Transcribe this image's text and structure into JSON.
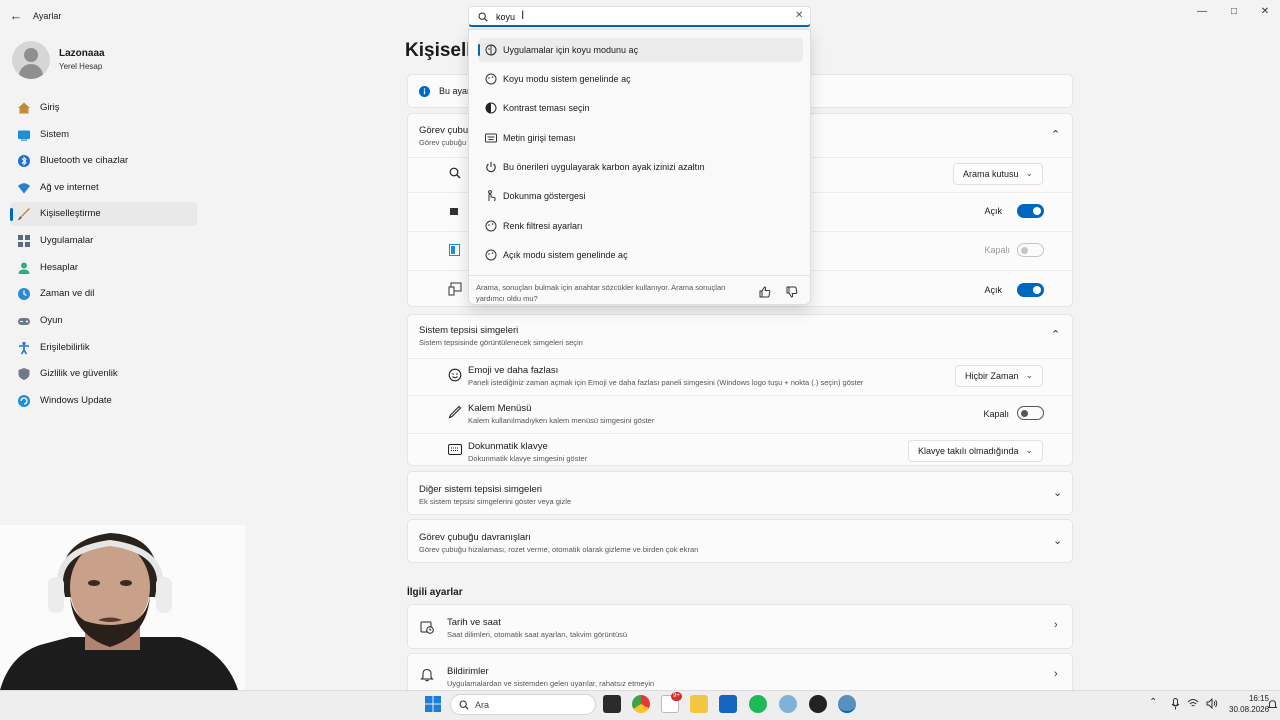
{
  "window": {
    "title": "Ayarlar"
  },
  "account": {
    "name": "Lazonaaa",
    "type": "Yerel Hesap"
  },
  "sidebar": {
    "items": [
      {
        "label": "Giriş",
        "icon": "home-icon",
        "color": "#c58b3a"
      },
      {
        "label": "Sistem",
        "icon": "monitor-icon",
        "color": "#1e8fd6"
      },
      {
        "label": "Bluetooth ve cihazlar",
        "icon": "bluetooth-icon",
        "color": "#1e6fd6"
      },
      {
        "label": "Ağ ve internet",
        "icon": "wifi-icon",
        "color": "#2a7fd0"
      },
      {
        "label": "Kişiselleştirme",
        "icon": "brush-icon",
        "color": "#d08030",
        "active": true
      },
      {
        "label": "Uygulamalar",
        "icon": "apps-icon",
        "color": "#5a6b7d"
      },
      {
        "label": "Hesaplar",
        "icon": "person-icon",
        "color": "#2bb07a"
      },
      {
        "label": "Zaman ve dil",
        "icon": "globe-clock-icon",
        "color": "#2b8ad0"
      },
      {
        "label": "Oyun",
        "icon": "gamepad-icon",
        "color": "#6b7a88"
      },
      {
        "label": "Erişilebilirlik",
        "icon": "accessibility-icon",
        "color": "#1e6fd6"
      },
      {
        "label": "Gizlilik ve güvenlik",
        "icon": "shield-icon",
        "color": "#707a85"
      },
      {
        "label": "Windows Update",
        "icon": "update-icon",
        "color": "#1e8fd6"
      }
    ]
  },
  "page": {
    "title": "Kişiselle"
  },
  "info_bar": {
    "text": "Bu ayar"
  },
  "taskbar_card": {
    "title": "Görev çubuğ",
    "sub": "Görev çubuğu"
  },
  "taskbar_rows": {
    "search_dropdown": "Arama kutusu",
    "row2_state": "Açık",
    "row3_state": "Kapalı",
    "row4_state": "Açık"
  },
  "tray_card": {
    "title": "Sistem tepsisi simgeleri",
    "sub": "Sistem tepsisinde görüntülenecek simgeleri seçin",
    "rows": [
      {
        "title": "Emoji ve daha fazlası",
        "sub": "Paneli istediğiniz zaman açmak için Emoji ve daha fazlası paneli simgesini (Windows logo tuşu + nokta (.) seçin) göster",
        "value": "Hiçbir Zaman"
      },
      {
        "title": "Kalem Menüsü",
        "sub": "Kalem kullanılmadıyken kalem menüsü simgesini göster",
        "value": "Kapalı"
      },
      {
        "title": "Dokunmatik klavye",
        "sub": "Dokunmatik klavye simgesini göster",
        "value": "Klavye takılı olmadığında"
      }
    ]
  },
  "other_tray": {
    "title": "Diğer sistem tepsisi simgeleri",
    "sub": "Ek sistem tepsisi simgelerini göster veya gizle"
  },
  "behaviors": {
    "title": "Görev çubuğu davranışları",
    "sub": "Görev çubuğu hizalaması, rozet verme, otomatik olarak gizleme ve birden çok ekran"
  },
  "related": {
    "heading": "İlgili ayarlar",
    "items": [
      {
        "title": "Tarih ve saat",
        "sub": "Saat dilimleri, otomatik saat ayarları, takvim görüntüsü"
      },
      {
        "title": "Bildirimler",
        "sub": "Uygulamalardan ve sistemden gelen uyarılar, rahatsız etmeyin"
      }
    ]
  },
  "search": {
    "query": "koyu",
    "suggestions": [
      {
        "label": "Uygulamalar için koyu modunu aç",
        "icon": "theme-icon"
      },
      {
        "label": "Koyu modu sistem genelinde aç",
        "icon": "theme-icon"
      },
      {
        "label": "Kontrast teması seçin",
        "icon": "contrast-icon"
      },
      {
        "label": "Metin girişi teması",
        "icon": "keyboard-icon"
      },
      {
        "label": "Bu önerileri uygulayarak karbon ayak izinizi azaltın",
        "icon": "power-icon"
      },
      {
        "label": "Dokunma göstergesi",
        "icon": "touch-icon"
      },
      {
        "label": "Renk filtresi ayarları",
        "icon": "theme-icon"
      },
      {
        "label": "Açık modu sistem genelinde aç",
        "icon": "theme-icon"
      }
    ],
    "note": "Arama, sonuçları bulmak için anahtar sözcükler kullanıyor. Arama sonuçları yardımcı oldu mu?"
  },
  "taskbar": {
    "search_placeholder": "Ara",
    "time": "16:15",
    "date": "30.08.2026",
    "badge": "9+"
  }
}
